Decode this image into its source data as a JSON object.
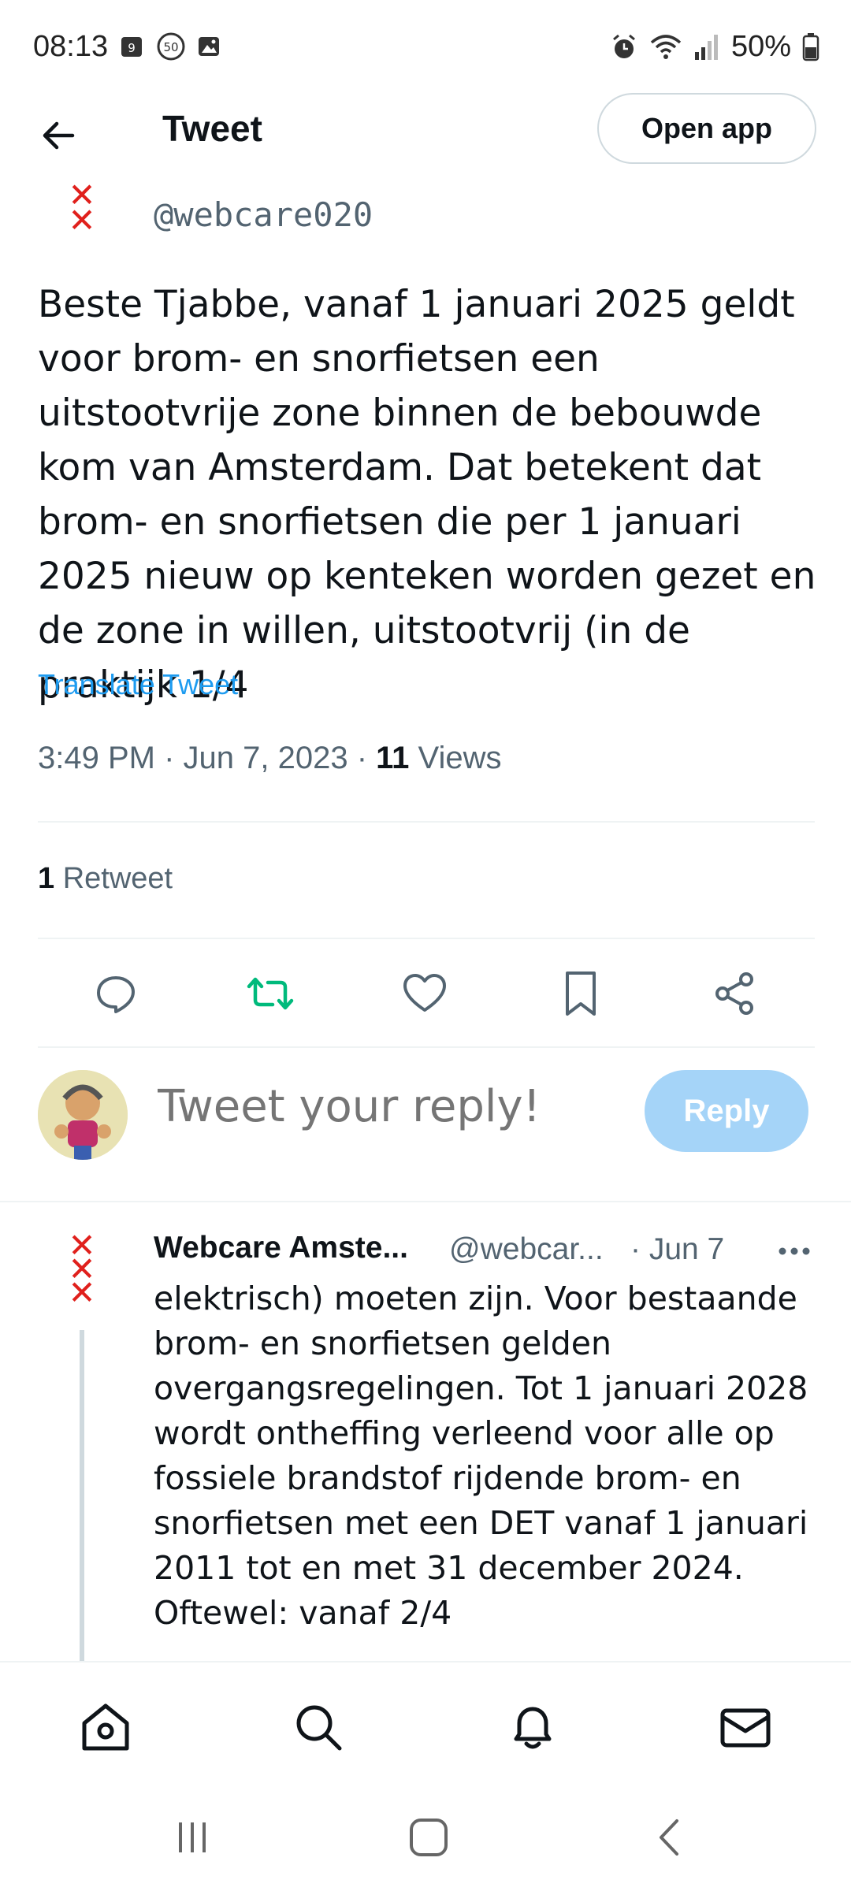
{
  "status_bar": {
    "time": "08:13",
    "notif_badge": "9",
    "speed_badge": "50",
    "battery": "50%"
  },
  "header": {
    "title": "Tweet",
    "open_app_label": "Open app"
  },
  "tweet": {
    "handle": "@webcare020",
    "text": "Beste Tjabbe, vanaf 1 januari 2025 geldt voor brom- en snorfietsen een uitstootvrije zone binnen de bebouwde kom van Amsterdam. Dat betekent dat brom- en snorfietsen die per 1 januari 2025 nieuw op kenteken worden gezet en de zone in willen, uitstootvrij (in de praktijk 1/4",
    "translate_label": "Translate Tweet",
    "timestamp": "3:49 PM · Jun 7, 2023 · ",
    "views_count": "11",
    "views_label": " Views",
    "retweets_count": "1",
    "retweets_label": " Retweet"
  },
  "reply_composer": {
    "placeholder": "Tweet your reply!",
    "button_label": "Reply"
  },
  "reply_tweet": {
    "name": "Webcare Amste...",
    "handle": "@webcar...",
    "date": "· Jun 7",
    "text": "elektrisch) moeten zijn. Voor bestaande brom- en snorfietsen gelden overgangsregelingen. Tot 1 januari 2028 wordt ontheffing verleend voor alle op fossiele brandstof rijdende brom- en snorfietsen met een DET vanaf 1 januari 2011 tot en met 31 december 2024. Oftewel: vanaf 2/4"
  },
  "colors": {
    "accent": "#1d9bf0",
    "retweet_active": "#00ba7c",
    "amsterdam_red": "#e0201c",
    "reply_button_disabled": "#a5d4f8"
  },
  "icons": {
    "back": "arrow-left-icon",
    "reply": "speech-bubble-icon",
    "retweet": "retweet-icon",
    "like": "heart-icon",
    "bookmark": "bookmark-icon",
    "share": "share-icon",
    "home": "home-icon",
    "search": "search-icon",
    "notifications": "bell-icon",
    "messages": "envelope-icon"
  }
}
